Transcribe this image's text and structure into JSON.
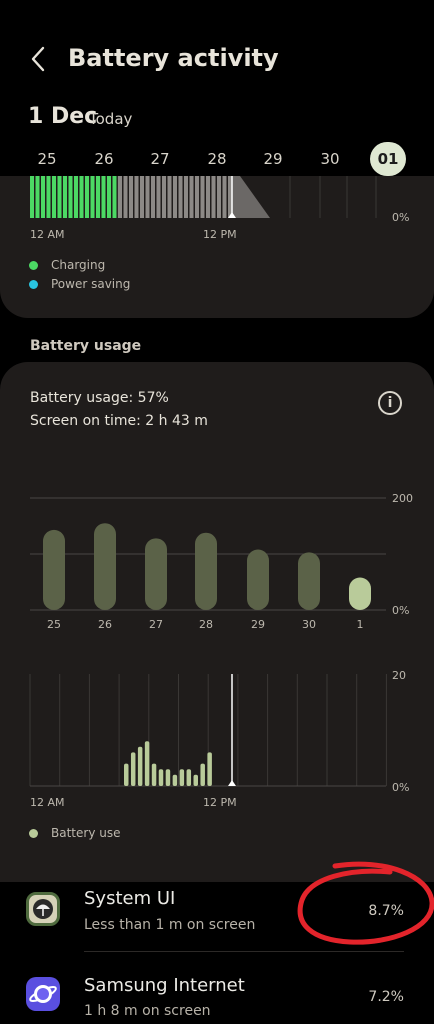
{
  "header": {
    "title": "Battery activity",
    "date_main": "1 Dec",
    "date_sub": "Today",
    "days": [
      "25",
      "26",
      "27",
      "28",
      "29",
      "30",
      "01"
    ],
    "selected_day": "01"
  },
  "battery_level_chart": {
    "x_labels": [
      "12 AM",
      "12 PM"
    ],
    "y_label": "0%",
    "legend": [
      {
        "label": "Charging",
        "color": "#4cd964"
      },
      {
        "label": "Power saving",
        "color": "#29c4e0"
      }
    ]
  },
  "battery_usage": {
    "section_title": "Battery usage",
    "usage_text": "Battery usage: 57%",
    "screen_time_text": "Screen on time: 2 h 43 m"
  },
  "chart_data": [
    {
      "type": "bar",
      "categories": [
        "25",
        "26",
        "27",
        "28",
        "29",
        "30",
        "1"
      ],
      "values": [
        143,
        155,
        128,
        138,
        108,
        103,
        58
      ],
      "ylim": [
        0,
        200
      ],
      "y_tick_labels": [
        "200",
        "0%"
      ],
      "highlight_color": "#b9cb9a",
      "bar_color": "#5b6248",
      "grid": true
    },
    {
      "type": "bar",
      "x_tick_labels": [
        "12 AM",
        "12 PM"
      ],
      "y_tick_labels": [
        "20",
        "0%"
      ],
      "ylim": [
        0,
        20
      ],
      "values": [
        4,
        6,
        7,
        8,
        4,
        3,
        3,
        2,
        3,
        3,
        2,
        4,
        6
      ],
      "legend": "Battery use",
      "bar_color": "#b9cb9a",
      "grid": true
    }
  ],
  "apps": [
    {
      "name": "System UI",
      "sub": "Less than 1 m on screen",
      "pct": "8.7%",
      "icon": "system-ui-icon"
    },
    {
      "name": "Samsung Internet",
      "sub": "1 h 8 m on screen",
      "pct": "7.2%",
      "icon": "samsung-internet-icon"
    }
  ],
  "colors": {
    "annotation": "#e3242b",
    "highlight_bar": "#b9cb9a"
  }
}
